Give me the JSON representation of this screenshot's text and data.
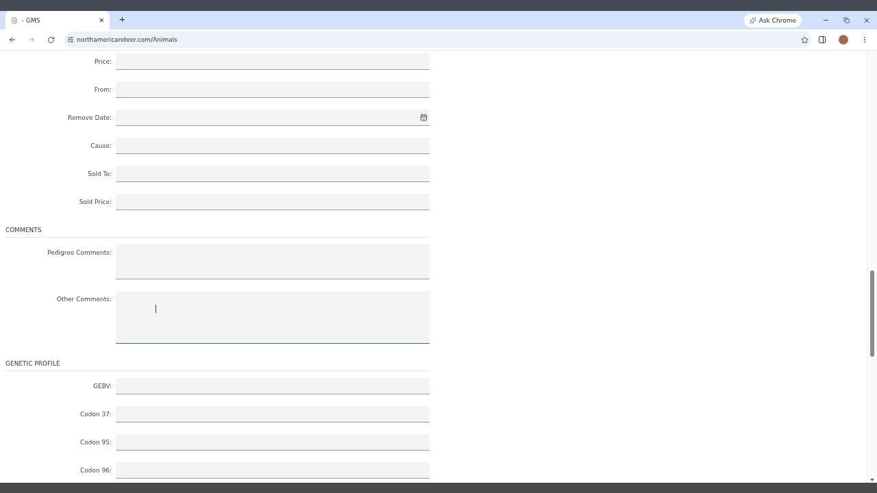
{
  "browser": {
    "tab_title": "- GMS",
    "tab_close": "×",
    "new_tab": "+",
    "ask_button": "Ask Chrome",
    "url": "northamericandeer.com/Animals"
  },
  "sections": [
    {
      "fields": [
        {
          "label": "Price:",
          "kind": "text",
          "focused": false
        },
        {
          "label": "From:",
          "kind": "text",
          "focused": false
        },
        {
          "label": "Remove Date:",
          "kind": "date",
          "focused": false
        },
        {
          "label": "Cause:",
          "kind": "text",
          "focused": false
        },
        {
          "label": "Sold To:",
          "kind": "text",
          "focused": false
        },
        {
          "label": "Sold Price:",
          "kind": "text",
          "focused": false
        }
      ]
    },
    {
      "title": "COMMENTS",
      "fields": [
        {
          "label": "Pedigree Comments:",
          "kind": "textarea",
          "focused": false
        },
        {
          "label": "Other Comments:",
          "kind": "textarea-tall",
          "focused": true
        }
      ]
    },
    {
      "title": "GENETIC PROFILE",
      "fields": [
        {
          "label": "GEBV:",
          "kind": "text",
          "focused": false
        },
        {
          "label": "Codon 37:",
          "kind": "text",
          "focused": false
        },
        {
          "label": "Codon 95:",
          "kind": "text",
          "focused": false
        },
        {
          "label": "Codon 96:",
          "kind": "text",
          "focused": false
        }
      ]
    }
  ]
}
